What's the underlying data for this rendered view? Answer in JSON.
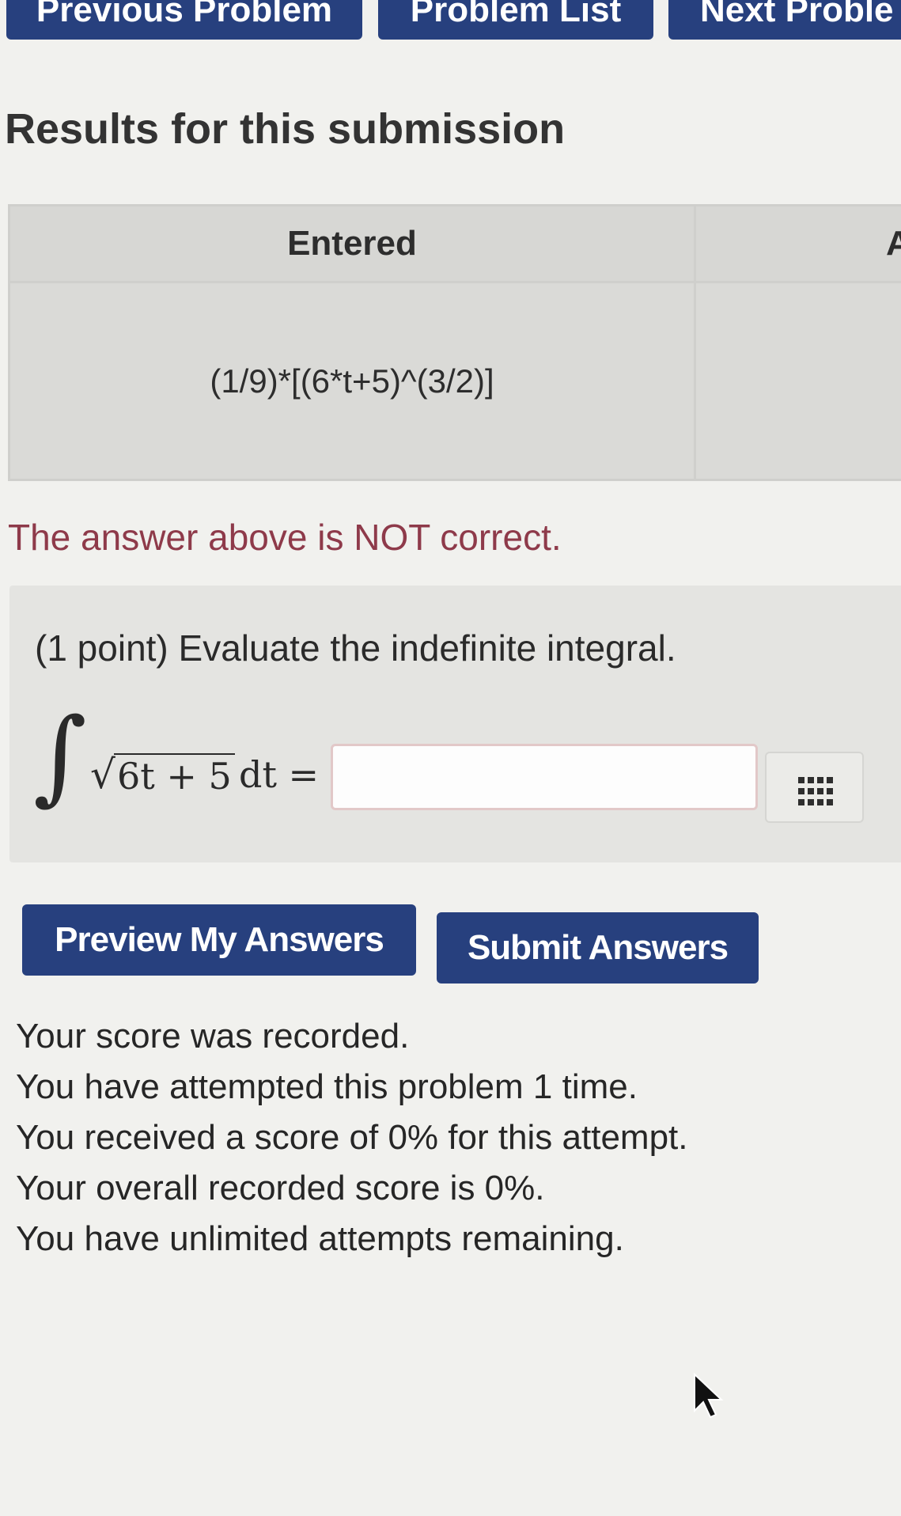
{
  "nav": {
    "previous": "Previous Problem",
    "list": "Problem List",
    "next": "Next Proble"
  },
  "results": {
    "title": "Results for this submission",
    "headers": [
      "Entered",
      "A"
    ],
    "entered_value": "(1/9)*[(6*t+5)^(3/2)]",
    "answer_preview": "",
    "status": "The answer above is NOT correct."
  },
  "problem": {
    "prompt": "(1 point) Evaluate the indefinite integral.",
    "integral_sign": "∫",
    "sqrt_sign": "√",
    "radicand": "6t + 5",
    "suffix": "dt =",
    "answer_value": ""
  },
  "buttons": {
    "preview": "Preview My Answers",
    "submit": "Submit Answers"
  },
  "messages": [
    "Your score was recorded.",
    "You have attempted this problem 1 time.",
    "You received a score of 0% for this attempt.",
    "Your overall recorded score is 0%.",
    "You have unlimited attempts remaining."
  ],
  "colors": {
    "button": "#27407e",
    "incorrect_text": "#8e3a4a",
    "background": "#f1f1ee"
  },
  "icons": {
    "equation_editor": "grid-dots-icon",
    "cursor": "mouse-pointer-icon"
  }
}
